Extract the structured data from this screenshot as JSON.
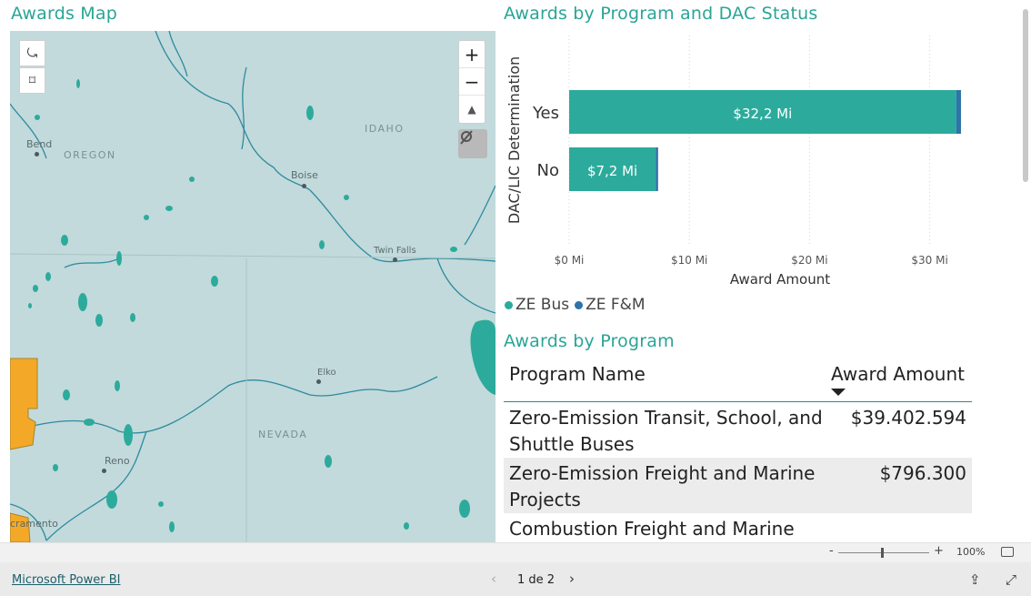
{
  "map": {
    "title": "Awards Map",
    "state_labels": [
      "OREGON",
      "IDAHO",
      "NEVADA"
    ],
    "cities": [
      "Bend",
      "Boise",
      "Twin Falls",
      "Elko",
      "Reno",
      "cramento"
    ],
    "controls": {
      "zoom_in": "+",
      "zoom_out": "−",
      "reset": "▲"
    }
  },
  "chart": {
    "title": "Awards by Program and DAC Status",
    "colors": {
      "ze_bus": "#2cab9c",
      "ze_fm": "#2f73a8"
    }
  },
  "chart_data": {
    "type": "bar",
    "orientation": "horizontal",
    "stacked": true,
    "categories": [
      "Yes",
      "No"
    ],
    "series": [
      {
        "name": "ZE Bus",
        "values": [
          32.2,
          7.2
        ]
      },
      {
        "name": "ZE F&M",
        "values": [
          0.4,
          0.2
        ]
      }
    ],
    "data_labels": [
      "$32,2 Mi",
      "$7,2 Mi"
    ],
    "xlabel": "Award Amount",
    "ylabel": "DAC/LIC Determination",
    "xticks": [
      "$0 Mi",
      "$10 Mi",
      "$20 Mi",
      "$30 Mi"
    ],
    "xlim": [
      0,
      33
    ],
    "grid": true,
    "legend_position": "bottom-left"
  },
  "legend": {
    "items": [
      "ZE Bus",
      "ZE F&M"
    ]
  },
  "table": {
    "title": "Awards by Program",
    "headers": {
      "name": "Program Name",
      "amount": "Award Amount"
    },
    "rows": [
      {
        "name": "Zero-Emission Transit, School, and Shuttle Buses",
        "amount": "$39.402.594"
      },
      {
        "name": "Zero-Emission Freight and Marine Projects",
        "amount": "$796.300"
      },
      {
        "name": "Combustion Freight and Marine",
        "amount": ""
      }
    ]
  },
  "zoom": {
    "minus": "-",
    "plus": "+",
    "percent": "100%"
  },
  "footer": {
    "brand": "Microsoft Power BI",
    "page": "1 de 2",
    "prev": "‹",
    "next": "›"
  }
}
